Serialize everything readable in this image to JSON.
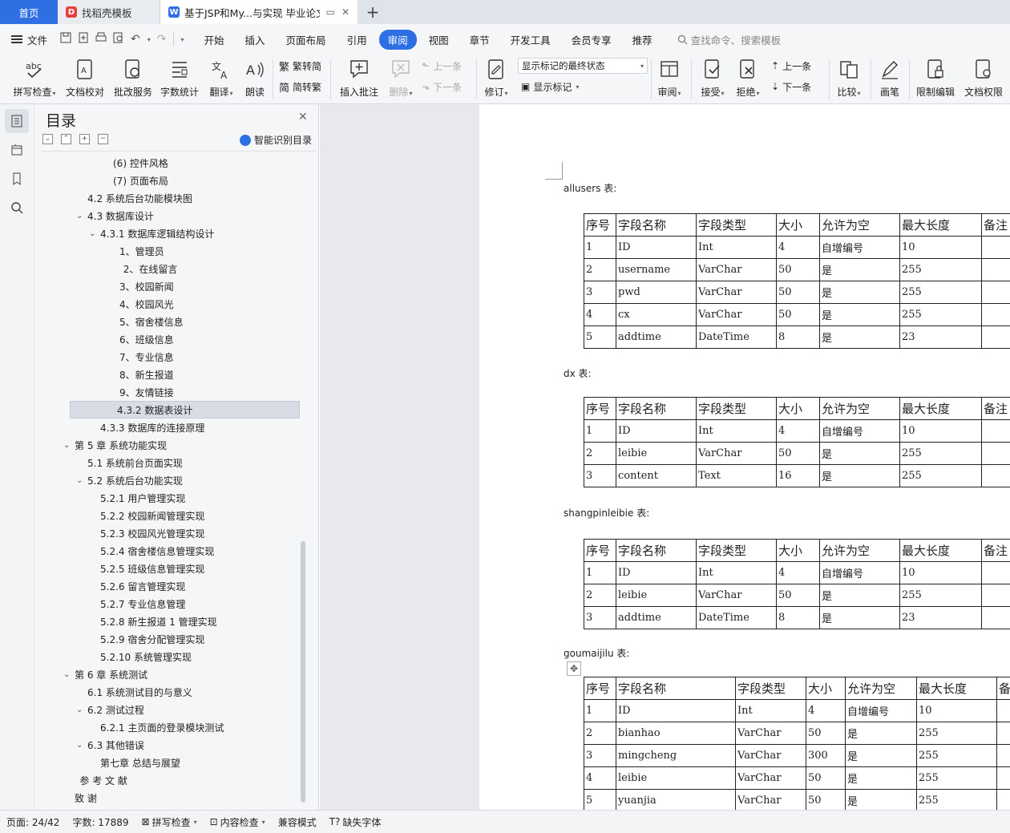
{
  "tabs": {
    "home": "首页",
    "template": "找稻壳模板",
    "document": "基于JSP和My...与实现 毕业论文"
  },
  "menubar": {
    "file": "文件",
    "items": [
      "开始",
      "插入",
      "页面布局",
      "引用",
      "审阅",
      "视图",
      "章节",
      "开发工具",
      "会员专享",
      "推荐"
    ],
    "active": "审阅",
    "search_placeholder": "查找命令、搜索模板"
  },
  "ribbon": {
    "spellcheck": "拼写检查",
    "doc_check": "文档校对",
    "batch_service": "批改服务",
    "word_count": "字数统计",
    "translate": "翻译",
    "read_aloud": "朗读",
    "trad": "繁转简",
    "simp": "简转繁",
    "insert_comment": "插入批注",
    "delete": "删除",
    "prev_comment": "上一条",
    "next_comment": "下一条",
    "revise": "修订",
    "markup_state": "显示标记的最终状态",
    "show_markup": "显示标记",
    "review": "审阅",
    "accept": "接受",
    "reject": "拒绝",
    "prev_change": "上一条",
    "next_change": "下一条",
    "compare": "比较",
    "pen": "画笔",
    "restrict_edit": "限制编辑",
    "doc_permission": "文档权限"
  },
  "toc": {
    "title": "目录",
    "smart": "智能识别目录",
    "items": [
      {
        "text": "(6)  控件风格",
        "indent": 4,
        "arrow": ""
      },
      {
        "text": "(7)  页面布局",
        "indent": 4,
        "arrow": ""
      },
      {
        "text": "4.2  系统后台功能模块图",
        "indent": 2,
        "arrow": ""
      },
      {
        "text": "4.3 数据库设计",
        "indent": 2,
        "arrow": "v"
      },
      {
        "text": "4.3.1 数据库逻辑结构设计",
        "indent": 3,
        "arrow": "v"
      },
      {
        "text": "1、管理员",
        "indent": 4.5,
        "arrow": ""
      },
      {
        "text": "2、在线留言",
        "indent": 4.8,
        "arrow": ""
      },
      {
        "text": "3、校园新闻",
        "indent": 4.5,
        "arrow": ""
      },
      {
        "text": "4、校园风光",
        "indent": 4.5,
        "arrow": ""
      },
      {
        "text": "5、宿舍楼信息",
        "indent": 4.5,
        "arrow": ""
      },
      {
        "text": "6、班级信息",
        "indent": 4.5,
        "arrow": ""
      },
      {
        "text": "7、专业信息",
        "indent": 4.5,
        "arrow": ""
      },
      {
        "text": "8、新生报道",
        "indent": 4.5,
        "arrow": ""
      },
      {
        "text": "9、友情链接",
        "indent": 4.5,
        "arrow": ""
      },
      {
        "text": "4.3.2  数据表设计",
        "indent": 3,
        "arrow": "",
        "selected": true
      },
      {
        "text": "4.3.3  数据库的连接原理",
        "indent": 3,
        "arrow": ""
      },
      {
        "text": "第 5 章  系统功能实现",
        "indent": 1,
        "arrow": "v"
      },
      {
        "text": "5.1  系统前台页面实现",
        "indent": 2,
        "arrow": ""
      },
      {
        "text": "5.2 系统后台功能实现",
        "indent": 2,
        "arrow": "v"
      },
      {
        "text": "5.2.1 用户管理实现",
        "indent": 3,
        "arrow": ""
      },
      {
        "text": "5.2.2  校园新闻管理实现",
        "indent": 3,
        "arrow": ""
      },
      {
        "text": "5.2.3  校园风光管理实现",
        "indent": 3,
        "arrow": ""
      },
      {
        "text": "5.2.4    宿舍楼信息管理实现",
        "indent": 3,
        "arrow": ""
      },
      {
        "text": "5.2.5  班级信息管理实现",
        "indent": 3,
        "arrow": ""
      },
      {
        "text": "5.2.6  留言管理实现",
        "indent": 3,
        "arrow": ""
      },
      {
        "text": "5.2.7  专业信息管理",
        "indent": 3,
        "arrow": ""
      },
      {
        "text": "5.2.8 新生报道 1 管理实现",
        "indent": 3,
        "arrow": ""
      },
      {
        "text": "5.2.9  宿舍分配管理实现",
        "indent": 3,
        "arrow": ""
      },
      {
        "text": "5.2.10  系统管理实现",
        "indent": 3,
        "arrow": ""
      },
      {
        "text": "第 6 章  系统测试",
        "indent": 1,
        "arrow": "v"
      },
      {
        "text": "6.1 系统测试目的与意义",
        "indent": 2,
        "arrow": ""
      },
      {
        "text": "6.2 测试过程",
        "indent": 2,
        "arrow": "v"
      },
      {
        "text": "6.2.1 主页面的登录模块测试",
        "indent": 3,
        "arrow": ""
      },
      {
        "text": "6.3 其他错误",
        "indent": 2,
        "arrow": "v"
      },
      {
        "text": "第七章  总结与展望",
        "indent": 3,
        "arrow": ""
      },
      {
        "text": "参  考  文  献",
        "indent": 1.4,
        "arrow": ""
      },
      {
        "text": "致  谢",
        "indent": 1,
        "arrow": ""
      }
    ]
  },
  "document": {
    "tables": [
      {
        "name": "allusers 表:",
        "header": [
          "序号",
          "字段名称",
          "字段类型",
          "大小",
          "允许为空",
          "最大长度",
          "备注"
        ],
        "rows": [
          [
            "1",
            "ID",
            "Int",
            "4",
            "自增编号",
            "10",
            ""
          ],
          [
            "2",
            "username",
            "VarChar",
            "50",
            "是",
            "255",
            ""
          ],
          [
            "3",
            "pwd",
            "VarChar",
            "50",
            "是",
            "255",
            ""
          ],
          [
            "4",
            "cx",
            "VarChar",
            "50",
            "是",
            "255",
            ""
          ],
          [
            "5",
            "addtime",
            "DateTime",
            "8",
            "是",
            "23",
            ""
          ]
        ]
      },
      {
        "name": "dx 表:",
        "header": [
          "序号",
          "字段名称",
          "字段类型",
          "大小",
          "允许为空",
          "最大长度",
          "备注"
        ],
        "rows": [
          [
            "1",
            "ID",
            "Int",
            "4",
            "自增编号",
            "10",
            ""
          ],
          [
            "2",
            "leibie",
            "VarChar",
            "50",
            "是",
            "255",
            ""
          ],
          [
            "3",
            "content",
            "Text",
            "16",
            "是",
            "255",
            ""
          ]
        ]
      },
      {
        "name": "shangpinleibie 表:",
        "header": [
          "序号",
          "字段名称",
          "字段类型",
          "大小",
          "允许为空",
          "最大长度",
          "备注"
        ],
        "rows": [
          [
            "1",
            "ID",
            "Int",
            "4",
            "自增编号",
            "10",
            ""
          ],
          [
            "2",
            "leibie",
            "VarChar",
            "50",
            "是",
            "255",
            ""
          ],
          [
            "3",
            "addtime",
            "DateTime",
            "8",
            "是",
            "23",
            ""
          ]
        ]
      },
      {
        "name": "goumaijilu 表:",
        "header": [
          "序号",
          "字段名称",
          "字段类型",
          "大小",
          "允许为空",
          "最大长度",
          "备注"
        ],
        "rows": [
          [
            "1",
            "ID",
            "Int",
            "4",
            "自增编号",
            "10",
            ""
          ],
          [
            "2",
            "bianhao",
            "VarChar",
            "50",
            "是",
            "255",
            ""
          ],
          [
            "3",
            "mingcheng",
            "VarChar",
            "300",
            "是",
            "255",
            ""
          ],
          [
            "4",
            "leibie",
            "VarChar",
            "50",
            "是",
            "255",
            ""
          ],
          [
            "5",
            "yuanjia",
            "VarChar",
            "50",
            "是",
            "255",
            ""
          ]
        ]
      }
    ]
  },
  "status": {
    "page": "页面: 24/42",
    "words": "字数: 17889",
    "spell": "拼写检查",
    "content_check": "内容检查",
    "compat": "兼容模式",
    "missing_font": "缺失字体"
  },
  "colors": {
    "accent": "#2f6fe4",
    "wps_red": "#e8413c"
  }
}
